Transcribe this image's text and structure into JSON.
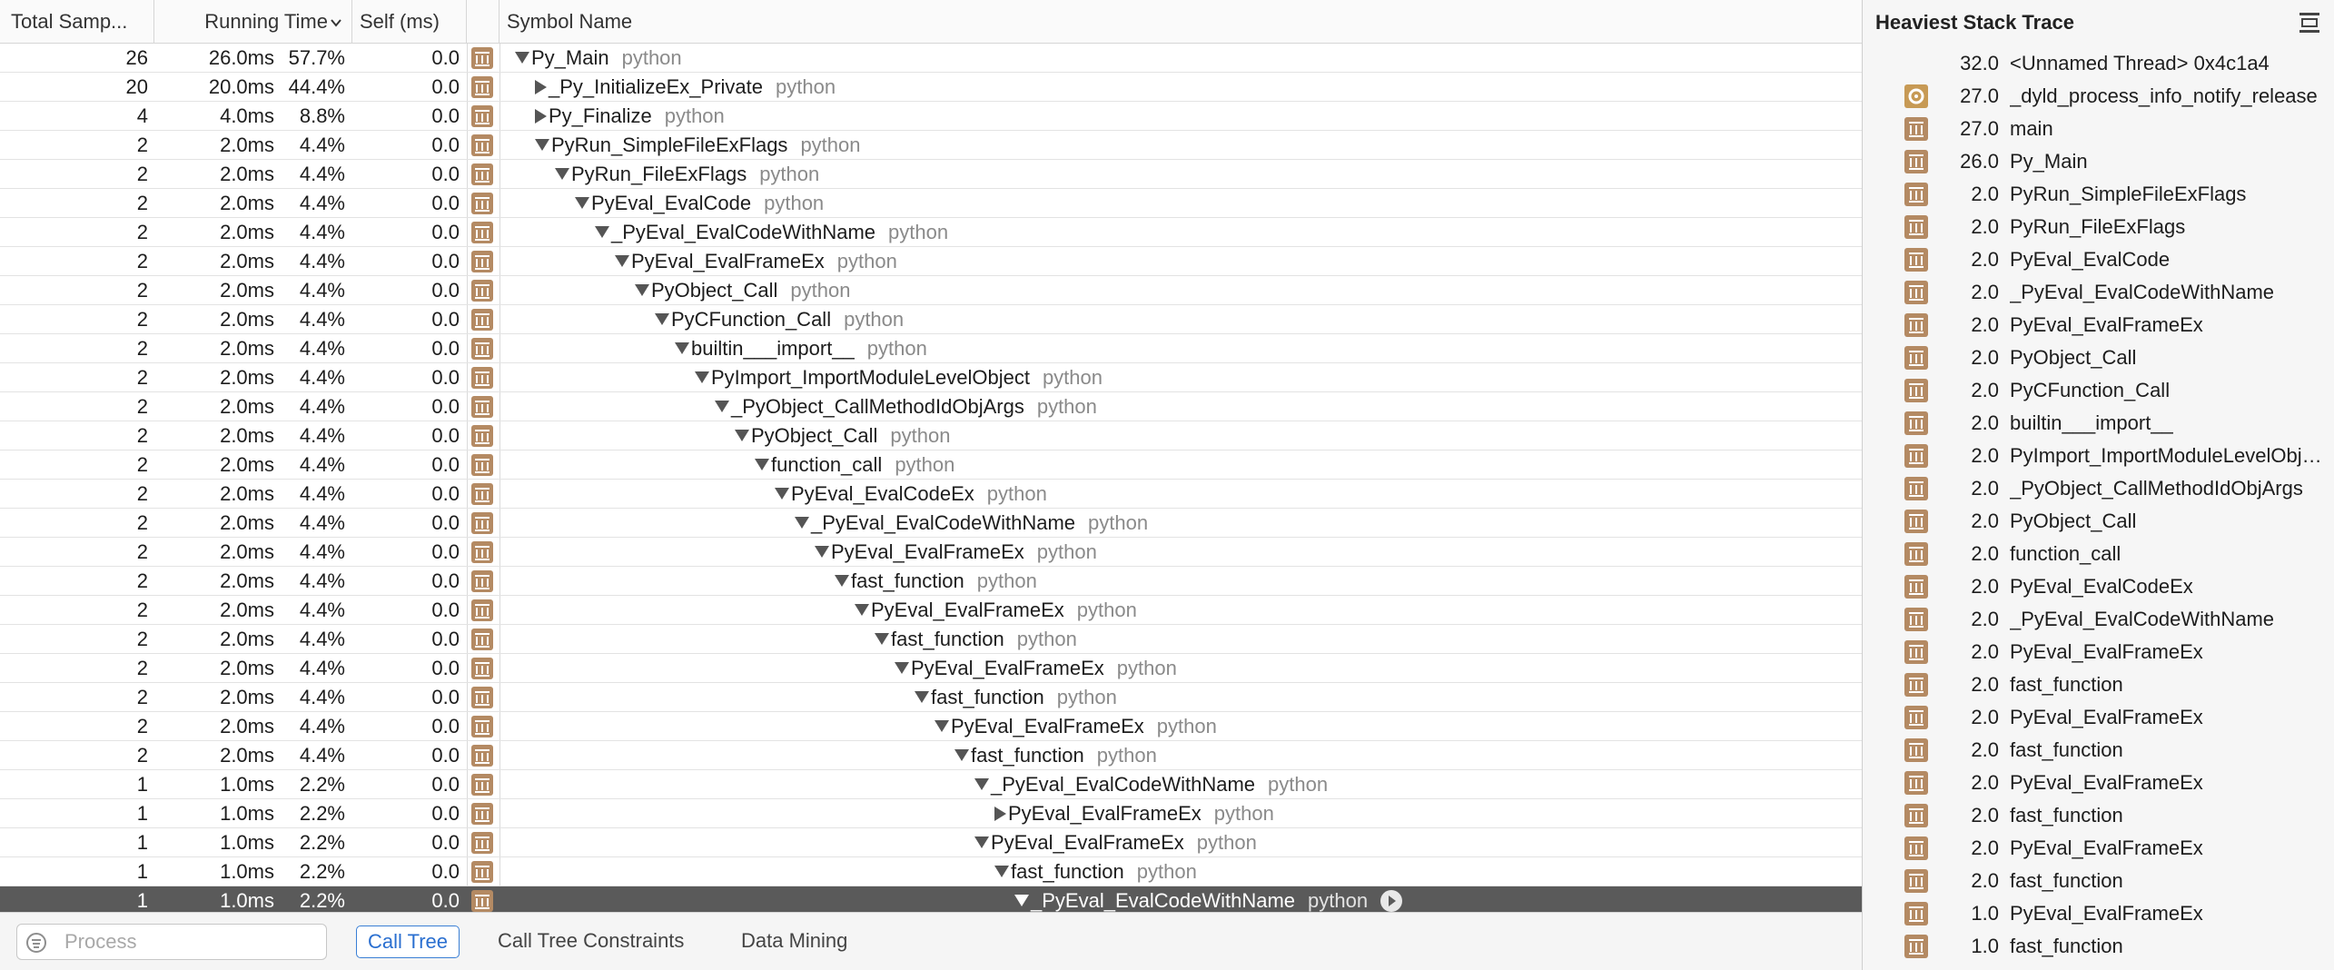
{
  "columns": {
    "total": "Total Samp...",
    "running": "Running Time",
    "self": "Self (ms)",
    "symbol": "Symbol Name"
  },
  "rows": [
    {
      "total": "26",
      "time": "26.0ms",
      "pct": "57.7%",
      "self": "0.0",
      "symbol": "Py_Main",
      "lib": "python",
      "depth": 0,
      "expander": "down"
    },
    {
      "total": "20",
      "time": "20.0ms",
      "pct": "44.4%",
      "self": "0.0",
      "symbol": "_Py_InitializeEx_Private",
      "lib": "python",
      "depth": 1,
      "expander": "right"
    },
    {
      "total": "4",
      "time": "4.0ms",
      "pct": "8.8%",
      "self": "0.0",
      "symbol": "Py_Finalize",
      "lib": "python",
      "depth": 1,
      "expander": "right"
    },
    {
      "total": "2",
      "time": "2.0ms",
      "pct": "4.4%",
      "self": "0.0",
      "symbol": "PyRun_SimpleFileExFlags",
      "lib": "python",
      "depth": 1,
      "expander": "down"
    },
    {
      "total": "2",
      "time": "2.0ms",
      "pct": "4.4%",
      "self": "0.0",
      "symbol": "PyRun_FileExFlags",
      "lib": "python",
      "depth": 2,
      "expander": "down"
    },
    {
      "total": "2",
      "time": "2.0ms",
      "pct": "4.4%",
      "self": "0.0",
      "symbol": "PyEval_EvalCode",
      "lib": "python",
      "depth": 3,
      "expander": "down"
    },
    {
      "total": "2",
      "time": "2.0ms",
      "pct": "4.4%",
      "self": "0.0",
      "symbol": "_PyEval_EvalCodeWithName",
      "lib": "python",
      "depth": 4,
      "expander": "down"
    },
    {
      "total": "2",
      "time": "2.0ms",
      "pct": "4.4%",
      "self": "0.0",
      "symbol": "PyEval_EvalFrameEx",
      "lib": "python",
      "depth": 5,
      "expander": "down"
    },
    {
      "total": "2",
      "time": "2.0ms",
      "pct": "4.4%",
      "self": "0.0",
      "symbol": "PyObject_Call",
      "lib": "python",
      "depth": 6,
      "expander": "down"
    },
    {
      "total": "2",
      "time": "2.0ms",
      "pct": "4.4%",
      "self": "0.0",
      "symbol": "PyCFunction_Call",
      "lib": "python",
      "depth": 7,
      "expander": "down"
    },
    {
      "total": "2",
      "time": "2.0ms",
      "pct": "4.4%",
      "self": "0.0",
      "symbol": "builtin___import__",
      "lib": "python",
      "depth": 8,
      "expander": "down"
    },
    {
      "total": "2",
      "time": "2.0ms",
      "pct": "4.4%",
      "self": "0.0",
      "symbol": "PyImport_ImportModuleLevelObject",
      "lib": "python",
      "depth": 9,
      "expander": "down"
    },
    {
      "total": "2",
      "time": "2.0ms",
      "pct": "4.4%",
      "self": "0.0",
      "symbol": "_PyObject_CallMethodIdObjArgs",
      "lib": "python",
      "depth": 10,
      "expander": "down"
    },
    {
      "total": "2",
      "time": "2.0ms",
      "pct": "4.4%",
      "self": "0.0",
      "symbol": "PyObject_Call",
      "lib": "python",
      "depth": 11,
      "expander": "down"
    },
    {
      "total": "2",
      "time": "2.0ms",
      "pct": "4.4%",
      "self": "0.0",
      "symbol": "function_call",
      "lib": "python",
      "depth": 12,
      "expander": "down"
    },
    {
      "total": "2",
      "time": "2.0ms",
      "pct": "4.4%",
      "self": "0.0",
      "symbol": "PyEval_EvalCodeEx",
      "lib": "python",
      "depth": 13,
      "expander": "down"
    },
    {
      "total": "2",
      "time": "2.0ms",
      "pct": "4.4%",
      "self": "0.0",
      "symbol": "_PyEval_EvalCodeWithName",
      "lib": "python",
      "depth": 14,
      "expander": "down"
    },
    {
      "total": "2",
      "time": "2.0ms",
      "pct": "4.4%",
      "self": "0.0",
      "symbol": "PyEval_EvalFrameEx",
      "lib": "python",
      "depth": 15,
      "expander": "down"
    },
    {
      "total": "2",
      "time": "2.0ms",
      "pct": "4.4%",
      "self": "0.0",
      "symbol": "fast_function",
      "lib": "python",
      "depth": 16,
      "expander": "down"
    },
    {
      "total": "2",
      "time": "2.0ms",
      "pct": "4.4%",
      "self": "0.0",
      "symbol": "PyEval_EvalFrameEx",
      "lib": "python",
      "depth": 17,
      "expander": "down"
    },
    {
      "total": "2",
      "time": "2.0ms",
      "pct": "4.4%",
      "self": "0.0",
      "symbol": "fast_function",
      "lib": "python",
      "depth": 18,
      "expander": "down"
    },
    {
      "total": "2",
      "time": "2.0ms",
      "pct": "4.4%",
      "self": "0.0",
      "symbol": "PyEval_EvalFrameEx",
      "lib": "python",
      "depth": 19,
      "expander": "down"
    },
    {
      "total": "2",
      "time": "2.0ms",
      "pct": "4.4%",
      "self": "0.0",
      "symbol": "fast_function",
      "lib": "python",
      "depth": 20,
      "expander": "down"
    },
    {
      "total": "2",
      "time": "2.0ms",
      "pct": "4.4%",
      "self": "0.0",
      "symbol": "PyEval_EvalFrameEx",
      "lib": "python",
      "depth": 21,
      "expander": "down"
    },
    {
      "total": "2",
      "time": "2.0ms",
      "pct": "4.4%",
      "self": "0.0",
      "symbol": "fast_function",
      "lib": "python",
      "depth": 22,
      "expander": "down"
    },
    {
      "total": "1",
      "time": "1.0ms",
      "pct": "2.2%",
      "self": "0.0",
      "symbol": "_PyEval_EvalCodeWithName",
      "lib": "python",
      "depth": 23,
      "expander": "down"
    },
    {
      "total": "1",
      "time": "1.0ms",
      "pct": "2.2%",
      "self": "0.0",
      "symbol": "PyEval_EvalFrameEx",
      "lib": "python",
      "depth": 24,
      "expander": "right"
    },
    {
      "total": "1",
      "time": "1.0ms",
      "pct": "2.2%",
      "self": "0.0",
      "symbol": "PyEval_EvalFrameEx",
      "lib": "python",
      "depth": 23,
      "expander": "down"
    },
    {
      "total": "1",
      "time": "1.0ms",
      "pct": "2.2%",
      "self": "0.0",
      "symbol": "fast_function",
      "lib": "python",
      "depth": 24,
      "expander": "down"
    },
    {
      "total": "1",
      "time": "1.0ms",
      "pct": "2.2%",
      "self": "0.0",
      "symbol": "_PyEval_EvalCodeWithName",
      "lib": "python",
      "depth": 25,
      "expander": "down",
      "selected": true
    }
  ],
  "bottom": {
    "search_placeholder": "Process",
    "tabs": [
      "Call Tree",
      "Call Tree Constraints",
      "Data Mining"
    ],
    "active_tab": 0
  },
  "heaviest": {
    "title": "Heaviest Stack Trace",
    "thread": {
      "count": "32.0",
      "name": "<Unnamed Thread> 0x4c1a4"
    },
    "frames": [
      {
        "count": "27.0",
        "name": "_dyld_process_info_notify_release",
        "icon": "gear-icon"
      },
      {
        "count": "27.0",
        "name": "main",
        "icon": "library-icon"
      },
      {
        "count": "26.0",
        "name": "Py_Main",
        "icon": "library-icon"
      },
      {
        "count": "2.0",
        "name": "PyRun_SimpleFileExFlags",
        "icon": "library-icon"
      },
      {
        "count": "2.0",
        "name": "PyRun_FileExFlags",
        "icon": "library-icon"
      },
      {
        "count": "2.0",
        "name": "PyEval_EvalCode",
        "icon": "library-icon"
      },
      {
        "count": "2.0",
        "name": "_PyEval_EvalCodeWithName",
        "icon": "library-icon"
      },
      {
        "count": "2.0",
        "name": "PyEval_EvalFrameEx",
        "icon": "library-icon"
      },
      {
        "count": "2.0",
        "name": "PyObject_Call",
        "icon": "library-icon"
      },
      {
        "count": "2.0",
        "name": "PyCFunction_Call",
        "icon": "library-icon"
      },
      {
        "count": "2.0",
        "name": "builtin___import__",
        "icon": "library-icon"
      },
      {
        "count": "2.0",
        "name": "PyImport_ImportModuleLevelObject",
        "icon": "library-icon"
      },
      {
        "count": "2.0",
        "name": "_PyObject_CallMethodIdObjArgs",
        "icon": "library-icon"
      },
      {
        "count": "2.0",
        "name": "PyObject_Call",
        "icon": "library-icon"
      },
      {
        "count": "2.0",
        "name": "function_call",
        "icon": "library-icon"
      },
      {
        "count": "2.0",
        "name": "PyEval_EvalCodeEx",
        "icon": "library-icon"
      },
      {
        "count": "2.0",
        "name": "_PyEval_EvalCodeWithName",
        "icon": "library-icon"
      },
      {
        "count": "2.0",
        "name": "PyEval_EvalFrameEx",
        "icon": "library-icon"
      },
      {
        "count": "2.0",
        "name": "fast_function",
        "icon": "library-icon"
      },
      {
        "count": "2.0",
        "name": "PyEval_EvalFrameEx",
        "icon": "library-icon"
      },
      {
        "count": "2.0",
        "name": "fast_function",
        "icon": "library-icon"
      },
      {
        "count": "2.0",
        "name": "PyEval_EvalFrameEx",
        "icon": "library-icon"
      },
      {
        "count": "2.0",
        "name": "fast_function",
        "icon": "library-icon"
      },
      {
        "count": "2.0",
        "name": "PyEval_EvalFrameEx",
        "icon": "library-icon"
      },
      {
        "count": "2.0",
        "name": "fast_function",
        "icon": "library-icon"
      },
      {
        "count": "1.0",
        "name": "PyEval_EvalFrameEx",
        "icon": "library-icon"
      },
      {
        "count": "1.0",
        "name": "fast_function",
        "icon": "library-icon"
      }
    ]
  },
  "colors": {
    "library_icon": "#b48a63",
    "selection": "#5a5a5a",
    "accent": "#3a7fd5"
  }
}
